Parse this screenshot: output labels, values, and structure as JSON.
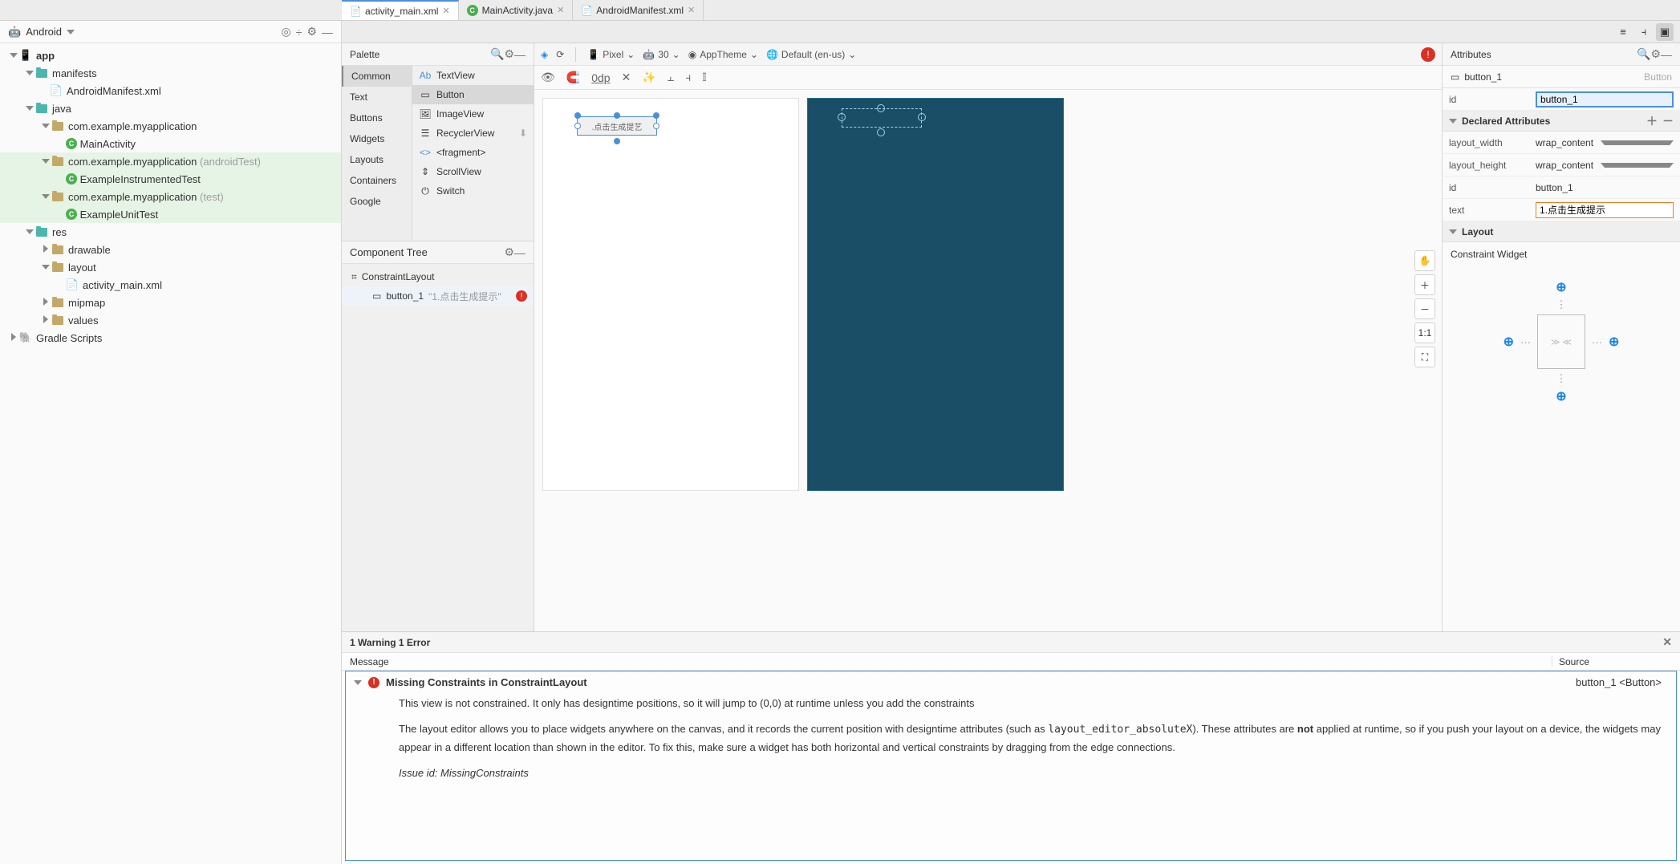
{
  "projectPanel": {
    "dropdown": "Android",
    "tree": {
      "app": "app",
      "manifests": "manifests",
      "manifestFile": "AndroidManifest.xml",
      "java": "java",
      "pkg1": "com.example.myapplication",
      "mainActivity": "MainActivity",
      "pkg2": "com.example.myapplication",
      "pkg2Suffix": "(androidTest)",
      "exampleInstr": "ExampleInstrumentedTest",
      "pkg3": "com.example.myapplication",
      "pkg3Suffix": "(test)",
      "exampleUnit": "ExampleUnitTest",
      "res": "res",
      "drawable": "drawable",
      "layout": "layout",
      "activityMain": "activity_main.xml",
      "mipmap": "mipmap",
      "values": "values",
      "gradle": "Gradle Scripts"
    }
  },
  "editorTabs": {
    "t1": "activity_main.xml",
    "t2": "MainActivity.java",
    "t3": "AndroidManifest.xml"
  },
  "palette": {
    "title": "Palette",
    "cats": {
      "common": "Common",
      "text": "Text",
      "buttons": "Buttons",
      "widgets": "Widgets",
      "layouts": "Layouts",
      "containers": "Containers",
      "google": "Google"
    },
    "items": {
      "textview": "TextView",
      "button": "Button",
      "imageview": "ImageView",
      "recycler": "RecyclerView",
      "fragment": "<fragment>",
      "scroll": "ScrollView",
      "switch": "Switch"
    }
  },
  "componentTree": {
    "title": "Component Tree",
    "root": "ConstraintLayout",
    "btn": "button_1",
    "btnText": "\"1.点击生成提示\""
  },
  "canvasToolbar": {
    "device": "Pixel",
    "api": "30",
    "theme": "AppTheme",
    "locale": "Default (en-us)",
    "zero": "0dp"
  },
  "canvasWidget": {
    "label": ".点击生成提艺"
  },
  "sideTools": {
    "oneToOne": "1:1"
  },
  "attributes": {
    "title": "Attributes",
    "selectedName": "button_1",
    "selectedType": "Button",
    "idLabel": "id",
    "idValue": "button_1",
    "declared": "Declared Attributes",
    "layoutWidth": "layout_width",
    "layoutWidthVal": "wrap_content",
    "layoutHeight": "layout_height",
    "layoutHeightVal": "wrap_content",
    "id2Label": "id",
    "id2Value": "button_1",
    "textLabel": "text",
    "textValue": "1.点击生成提示",
    "layoutSection": "Layout",
    "constraintWidget": "Constraint Widget"
  },
  "messages": {
    "header": "1 Warning 1 Error",
    "colMessage": "Message",
    "colSource": "Source",
    "errorTitle": "Missing Constraints in ConstraintLayout",
    "errorSource": "button_1 <Button>",
    "p1": "This view is not constrained. It only has designtime positions, so it will jump to (0,0) at runtime unless you add the constraints",
    "p2a": "The layout editor allows you to place widgets anywhere on the canvas, and it records the current position with designtime attributes (such as ",
    "p2code": "layout_editor_absoluteX",
    "p2b": "). These attributes are ",
    "p2bold": "not",
    "p2c": " applied at runtime, so if you push your layout on a device, the widgets may appear in a different location than shown in the editor. To fix this, make sure a widget has both horizontal and vertical constraints by dragging from the edge connections.",
    "issue": "Issue id: MissingConstraints"
  }
}
